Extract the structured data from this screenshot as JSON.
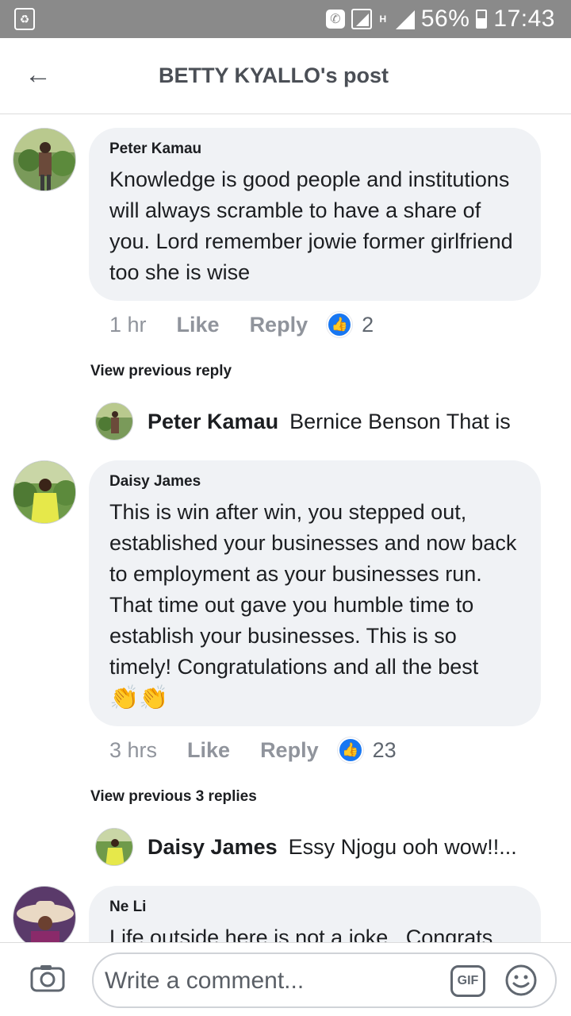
{
  "status_bar": {
    "battery": "56%",
    "time": "17:43",
    "network": "H"
  },
  "header": {
    "title": "BETTY KYALLO's post"
  },
  "comments": [
    {
      "author": "Peter Kamau",
      "text": "Knowledge is good people and institutions will always scramble to have a share of you. Lord remember jowie former girlfriend too she is wise",
      "time": "1 hr",
      "like_label": "Like",
      "reply_label": "Reply",
      "like_count": "2"
    },
    {
      "author": "Daisy James",
      "text": "This is win after win, you stepped out, established your businesses and now back to employment as your businesses run. That time out gave you humble time to establish your businesses. This is so timely! Congratulations and all the best",
      "emoji": "👏👏",
      "time": "3 hrs",
      "like_label": "Like",
      "reply_label": "Reply",
      "like_count": "23"
    },
    {
      "author": "Ne Li",
      "text": "Life outside here is not a joke . Congrats"
    }
  ],
  "view_previous": [
    "View previous reply",
    "View previous 3 replies"
  ],
  "reply_previews": [
    {
      "author": "Peter Kamau",
      "text": "Bernice Benson That is"
    },
    {
      "author": "Daisy James",
      "text": "Essy Njogu ooh wow!!..."
    }
  ],
  "composer": {
    "placeholder": "Write a comment...",
    "gif_label": "GIF"
  },
  "colors": {
    "like_badge": "#1877f2",
    "bubble": "#f0f2f5",
    "status_bar": "#8a8a8a"
  }
}
